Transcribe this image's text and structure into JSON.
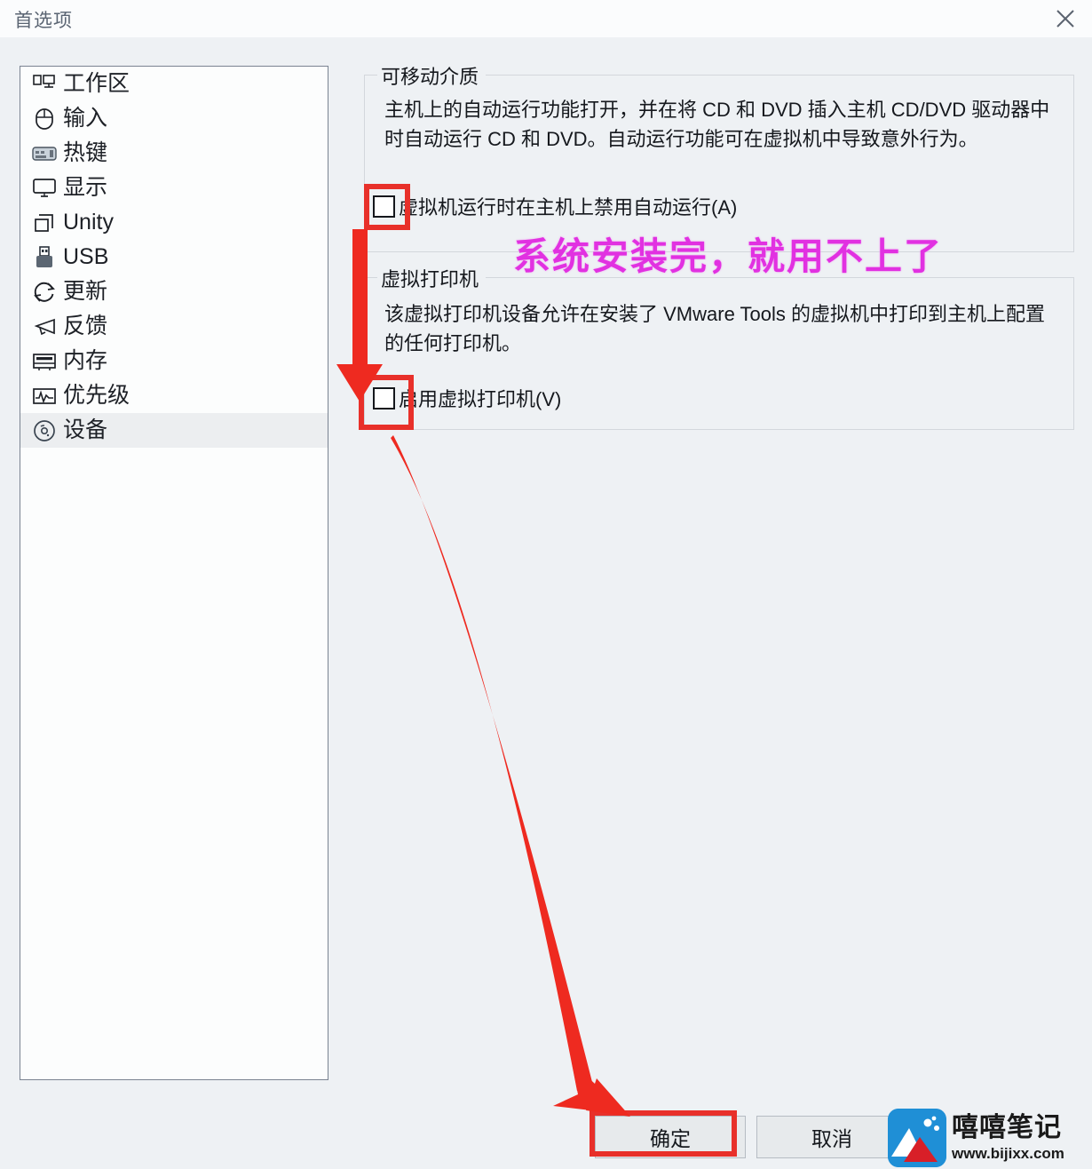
{
  "window": {
    "title": "首选项",
    "close_icon": "close-icon"
  },
  "sidebar": {
    "items": [
      {
        "label": "工作区",
        "icon": "workspace-icon",
        "selected": false
      },
      {
        "label": "输入",
        "icon": "mouse-icon",
        "selected": false
      },
      {
        "label": "热键",
        "icon": "keyboard-icon",
        "selected": false
      },
      {
        "label": "显示",
        "icon": "display-icon",
        "selected": false
      },
      {
        "label": "Unity",
        "icon": "unity-icon",
        "selected": false
      },
      {
        "label": "USB",
        "icon": "usb-icon",
        "selected": false
      },
      {
        "label": "更新",
        "icon": "refresh-icon",
        "selected": false
      },
      {
        "label": "反馈",
        "icon": "megaphone-icon",
        "selected": false
      },
      {
        "label": "内存",
        "icon": "memory-icon",
        "selected": false
      },
      {
        "label": "优先级",
        "icon": "priority-icon",
        "selected": false
      },
      {
        "label": "设备",
        "icon": "disc-icon",
        "selected": true
      }
    ]
  },
  "main": {
    "removable_media": {
      "legend": "可移动介质",
      "description": "主机上的自动运行功能打开，并在将 CD 和 DVD 插入主机 CD/DVD 驱动器中时自动运行 CD 和 DVD。自动运行功能可在虚拟机中导致意外行为。",
      "checkbox": {
        "label": "虚拟机运行时在主机上禁用自动运行(A)",
        "checked": false
      }
    },
    "virtual_printer": {
      "legend": "虚拟打印机",
      "description": "该虚拟打印机设备允许在安装了 VMware Tools 的虚拟机中打印到主机上配置的任何打印机。",
      "checkbox": {
        "label": "启用虚拟打印机(V)",
        "checked": false
      }
    }
  },
  "annotations": {
    "note_text": "系统安装完，就用不上了",
    "note_color": "#e131e1",
    "highlight_color": "#e8302a",
    "arrow_color": "#ee2a20"
  },
  "footer": {
    "ok_label": "确定",
    "cancel_label": "取消"
  },
  "watermark": {
    "title": "嘻嘻笔记",
    "url": "www.bijixx.com"
  }
}
